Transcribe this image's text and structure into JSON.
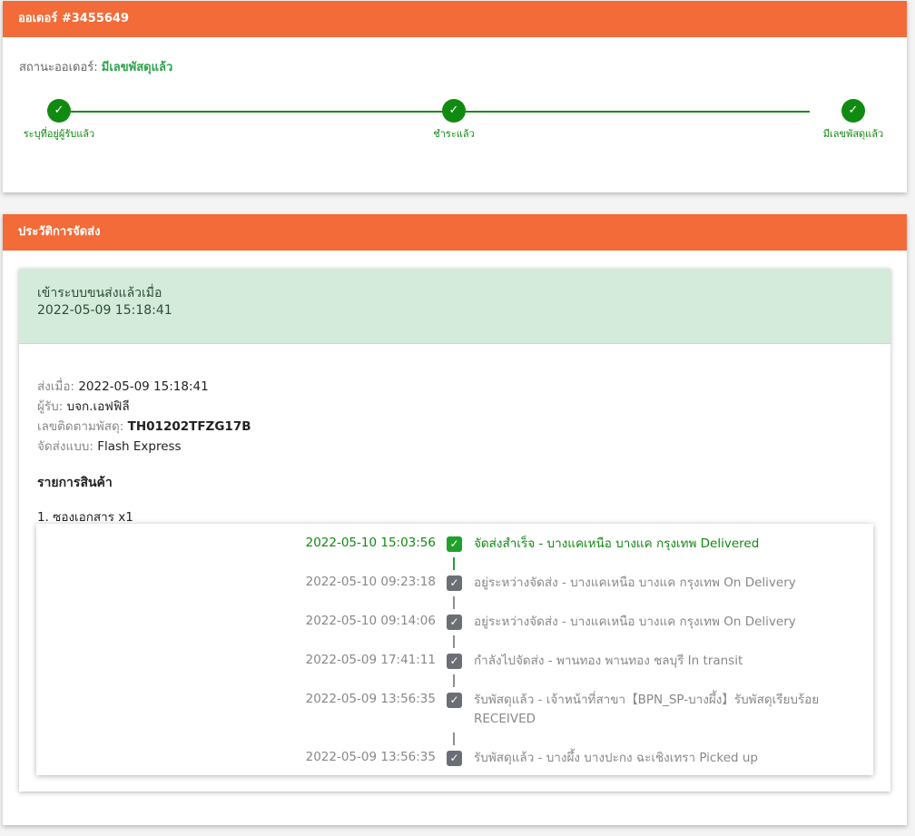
{
  "order_card": {
    "title": "ออเดอร์ #3455649",
    "status_label": "สถานะออเดอร์:",
    "status_value": "มีเลขพัสดุแล้ว",
    "steps": [
      {
        "icon": "check-icon",
        "label": "ระบุที่อยู่ผู้รับแล้ว"
      },
      {
        "icon": "check-icon",
        "label": "ชำระแล้ว"
      },
      {
        "icon": "check-icon",
        "label": "มีเลขพัสดุแล้ว"
      }
    ]
  },
  "history_card": {
    "title": "ประวัติการจัดส่ง",
    "alert": {
      "line1": "เข้าระบบขนส่งแล้วเมื่อ",
      "line2": "2022-05-09 15:18:41"
    },
    "info": {
      "sent_label": "ส่งเมื่อ:",
      "sent_value": "2022-05-09 15:18:41",
      "recipient_label": "ผู้รับ:",
      "recipient_value": "บจก.เอฟฟิลี",
      "tracking_label": "เลขติดตามพัสดุ:",
      "tracking_value": "TH01202TFZG17B",
      "method_label": "จัดส่งแบบ:",
      "method_value": "Flash Express"
    },
    "items_title": "รายการสินค้า",
    "items": [
      "1. ซองเอกสาร x1"
    ],
    "timeline": [
      {
        "time": "2022-05-10 15:03:56",
        "desc": "จัดส่งสำเร็จ - บางแคเหนือ บางแค กรุงเทพ Delivered",
        "status": "done",
        "icon": "check-icon"
      },
      {
        "time": "2022-05-10 09:23:18",
        "desc": "อยู่ระหว่างจัดส่ง - บางแคเหนือ บางแค กรุงเทพ On Delivery",
        "status": "normal",
        "icon": "check-icon"
      },
      {
        "time": "2022-05-10 09:14:06",
        "desc": "อยู่ระหว่างจัดส่ง - บางแคเหนือ บางแค กรุงเทพ On Delivery",
        "status": "normal",
        "icon": "check-icon"
      },
      {
        "time": "2022-05-09 17:41:11",
        "desc": "กำลังไปจัดส่ง - พานทอง พานทอง ชลบุรี In transit",
        "status": "normal",
        "icon": "check-icon"
      },
      {
        "time": "2022-05-09 13:56:35",
        "desc": "รับพัสดุแล้ว - เจ้าหน้าที่สาขา【BPN_SP-บางผึ้ง】รับพัสดุเรียบร้อย RECEIVED",
        "status": "normal",
        "icon": "check-icon"
      },
      {
        "time": "2022-05-09 13:56:35",
        "desc": "รับพัสดุแล้ว - บางผึ้ง บางปะกง ฉะเชิงเทรา Picked up",
        "status": "normal",
        "icon": "check-icon"
      }
    ]
  },
  "colors": {
    "header": "#f26b38",
    "success": "#118a11",
    "alert_bg": "#d4ebdb",
    "pending_box": "#6b6f75"
  }
}
